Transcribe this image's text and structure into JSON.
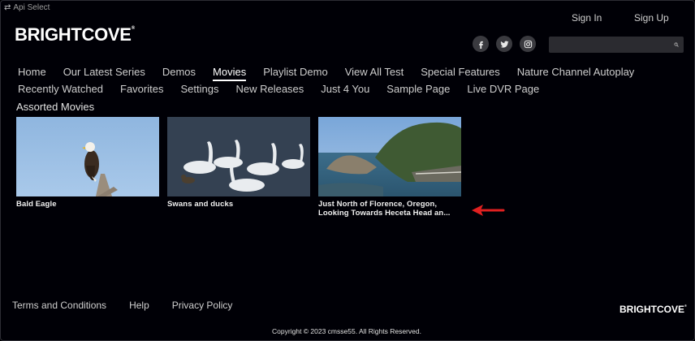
{
  "api_select": {
    "label": "Api Select",
    "icon": "swap-icon"
  },
  "brand": {
    "logo_text": "BRIGHTCOVE",
    "trademark": "®"
  },
  "header": {
    "sign_in": "Sign In",
    "sign_up": "Sign Up"
  },
  "social": {
    "icons": [
      "facebook-icon",
      "twitter-icon",
      "instagram-icon"
    ]
  },
  "search": {
    "placeholder": "",
    "value": ""
  },
  "nav": {
    "items": [
      {
        "label": "Home"
      },
      {
        "label": "Our Latest Series"
      },
      {
        "label": "Demos"
      },
      {
        "label": "Movies",
        "active": true
      },
      {
        "label": "Playlist Demo"
      },
      {
        "label": "View All Test"
      },
      {
        "label": "Special Features"
      },
      {
        "label": "Nature Channel Autoplay"
      },
      {
        "label": "Recently Watched"
      },
      {
        "label": "Favorites"
      },
      {
        "label": "Settings"
      },
      {
        "label": "New Releases"
      },
      {
        "label": "Just 4 You"
      },
      {
        "label": "Sample Page"
      },
      {
        "label": "Live DVR Page"
      }
    ]
  },
  "section": {
    "title": "Assorted Movies"
  },
  "movies": [
    {
      "title": "Bald Eagle"
    },
    {
      "title": "Swans and ducks"
    },
    {
      "title": "Just North of Florence, Oregon, Looking Towards Heceta Head an..."
    }
  ],
  "footer": {
    "links": [
      "Terms and Conditions",
      "Help",
      "Privacy Policy"
    ],
    "logo_text": "BRIGHTCOVE",
    "copyright": "Copyright © 2023 cmsse55. All Rights Reserved."
  },
  "colors": {
    "background": "#000006",
    "accent_arrow": "#e02020",
    "active_underline": "#ffffff"
  }
}
